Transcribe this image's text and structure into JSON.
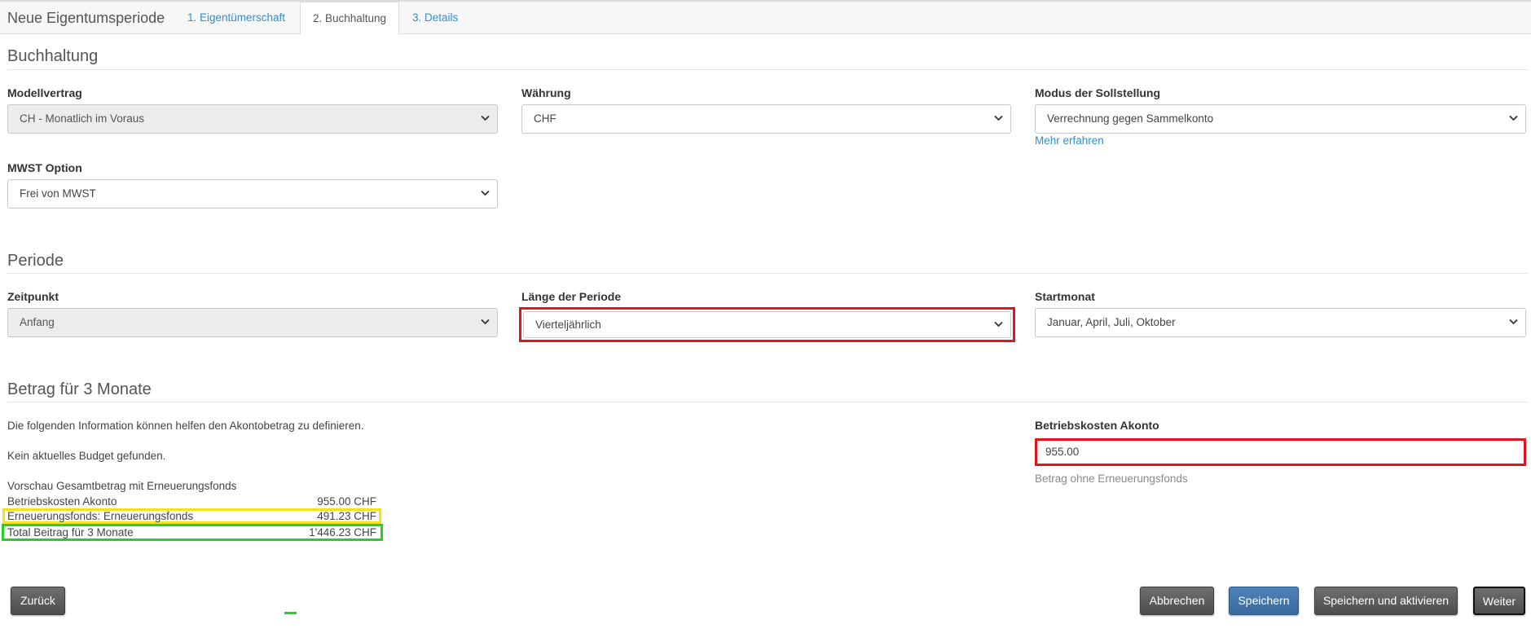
{
  "header": {
    "title": "Neue Eigentumsperiode",
    "tabs": [
      {
        "label": "1. Eigentümerschaft"
      },
      {
        "label": "2. Buchhaltung"
      },
      {
        "label": "3. Details"
      }
    ]
  },
  "buchhaltung": {
    "title": "Buchhaltung",
    "modellvertrag": {
      "label": "Modellvertrag",
      "value": "CH - Monatlich im Voraus"
    },
    "waehrung": {
      "label": "Währung",
      "value": "CHF"
    },
    "modus": {
      "label": "Modus der Sollstellung",
      "value": "Verrechnung gegen Sammelkonto",
      "link": "Mehr erfahren"
    },
    "mwst": {
      "label": "MWST Option",
      "value": "Frei von MWST"
    }
  },
  "periode": {
    "title": "Periode",
    "zeitpunkt": {
      "label": "Zeitpunkt",
      "value": "Anfang"
    },
    "laenge": {
      "label": "Länge der Periode",
      "value": "Vierteljährlich"
    },
    "startmonat": {
      "label": "Startmonat",
      "value": "Januar, April, Juli, Oktober"
    }
  },
  "betrag": {
    "title": "Betrag für 3 Monate",
    "info": "Die folgenden Information können helfen den Akontobetrag zu definieren.",
    "budget": "Kein aktuelles Budget gefunden.",
    "preview_title": "Vorschau Gesamtbetrag mit Erneuerungsfonds",
    "rows": [
      {
        "label": "Betriebskosten Akonto",
        "value": "955.00 CHF"
      },
      {
        "label": "Erneuerungsfonds: Erneuerungsfonds",
        "value": "491.23 CHF"
      },
      {
        "label": "Total Beitrag für 3 Monate",
        "value": "1'446.23 CHF"
      }
    ],
    "akonto": {
      "label": "Betriebskosten Akonto",
      "value": "955.00",
      "hint": "Betrag ohne Erneuerungsfonds"
    }
  },
  "footer": {
    "back": "Zurück",
    "cancel": "Abbrechen",
    "save": "Speichern",
    "save_activate": "Speichern und aktivieren",
    "next": "Weiter"
  },
  "colors": {
    "link": "#2f8ed6",
    "highlight_red": "#e0161f",
    "highlight_yellow": "#f3e21b",
    "highlight_green": "#22d124",
    "primary_button": "#3a6a9e"
  }
}
